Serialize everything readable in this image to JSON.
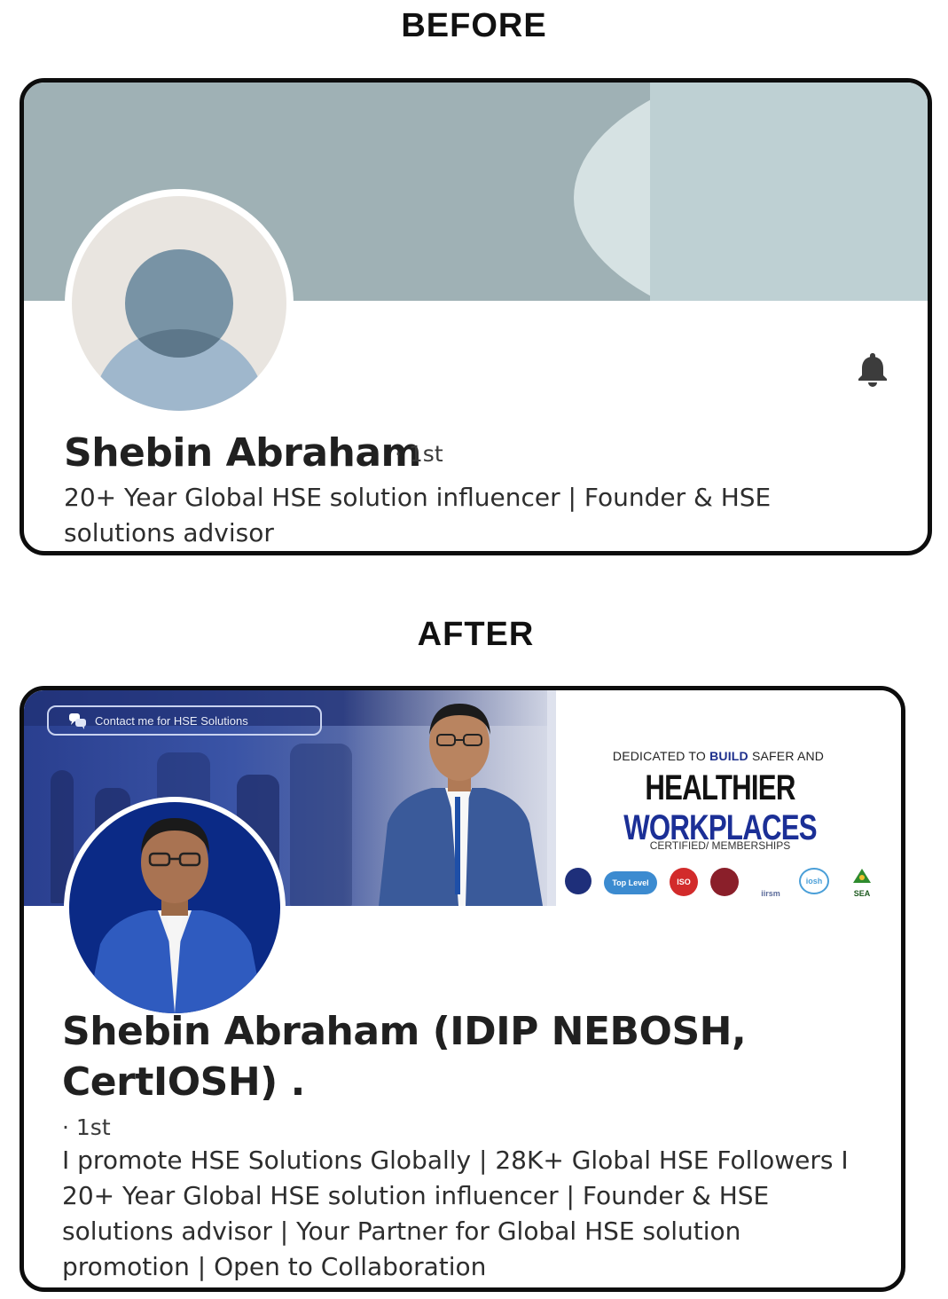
{
  "labels": {
    "before": "BEFORE",
    "after": "AFTER"
  },
  "before": {
    "name": "Shebin Abraham",
    "degree": "· 1st",
    "headline": "20+ Year Global HSE solution influencer | Founder & HSE solutions advisor",
    "icons": {
      "notify": "bell-icon",
      "avatar": "default-avatar-icon"
    }
  },
  "after": {
    "banner": {
      "contact_label": "Contact me for HSE Solutions",
      "tagline_prefix": "DEDICATED TO",
      "tagline_emphasis": "BUILD",
      "tagline_suffix": "SAFER AND",
      "headline_main": "HEALTHIER",
      "headline_accent": "WORKPLACES",
      "memberships_label": "CERTIFIED/ MEMBERSHIPS",
      "badges": [
        "",
        "Top Level",
        "ISO",
        "",
        "iirsm",
        "iosh",
        "SEA"
      ]
    },
    "name": "Shebin Abraham (IDIP NEBOSH, CertIOSH) .",
    "degree": "· 1st",
    "headline": "I promote HSE Solutions Globally | 28K+ Global HSE Followers I 20+ Year Global HSE solution influencer | Founder & HSE solutions advisor | Your Partner for Global HSE solution promotion | Open to Collaboration"
  },
  "colors": {
    "accent_blue": "#1b2f96",
    "banner_before": "#9fb1b5",
    "avatar_bg_after": "#0b2a86"
  }
}
